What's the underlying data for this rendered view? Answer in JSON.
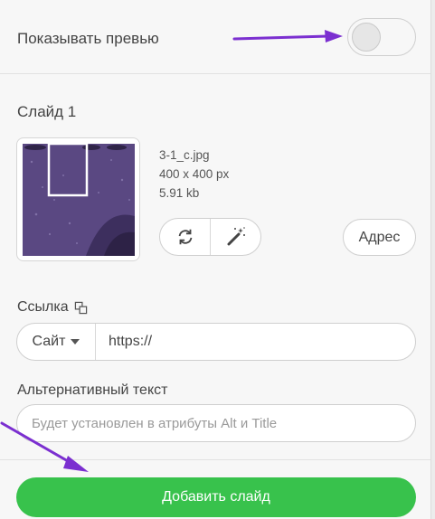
{
  "preview": {
    "label": "Показывать превью",
    "enabled": false
  },
  "slide": {
    "title": "Слайд 1",
    "file_name": "3-1_c.jpg",
    "dimensions": "400 x 400 px",
    "size": "5.91 kb",
    "replace_icon": "refresh-icon",
    "edit_icon": "magic-wand-icon",
    "address_button": "Адрес"
  },
  "link": {
    "label": "Ссылка",
    "icon": "copy-icon",
    "type_selected": "Сайт",
    "value": "https://"
  },
  "alt_text": {
    "label": "Альтернативный текст",
    "placeholder": "Будет установлен в атрибуты Alt и Title"
  },
  "footer": {
    "add_button": "Добавить слайд"
  },
  "colors": {
    "accent_green": "#38c24c",
    "annotation_arrow": "#7b2fd0"
  }
}
